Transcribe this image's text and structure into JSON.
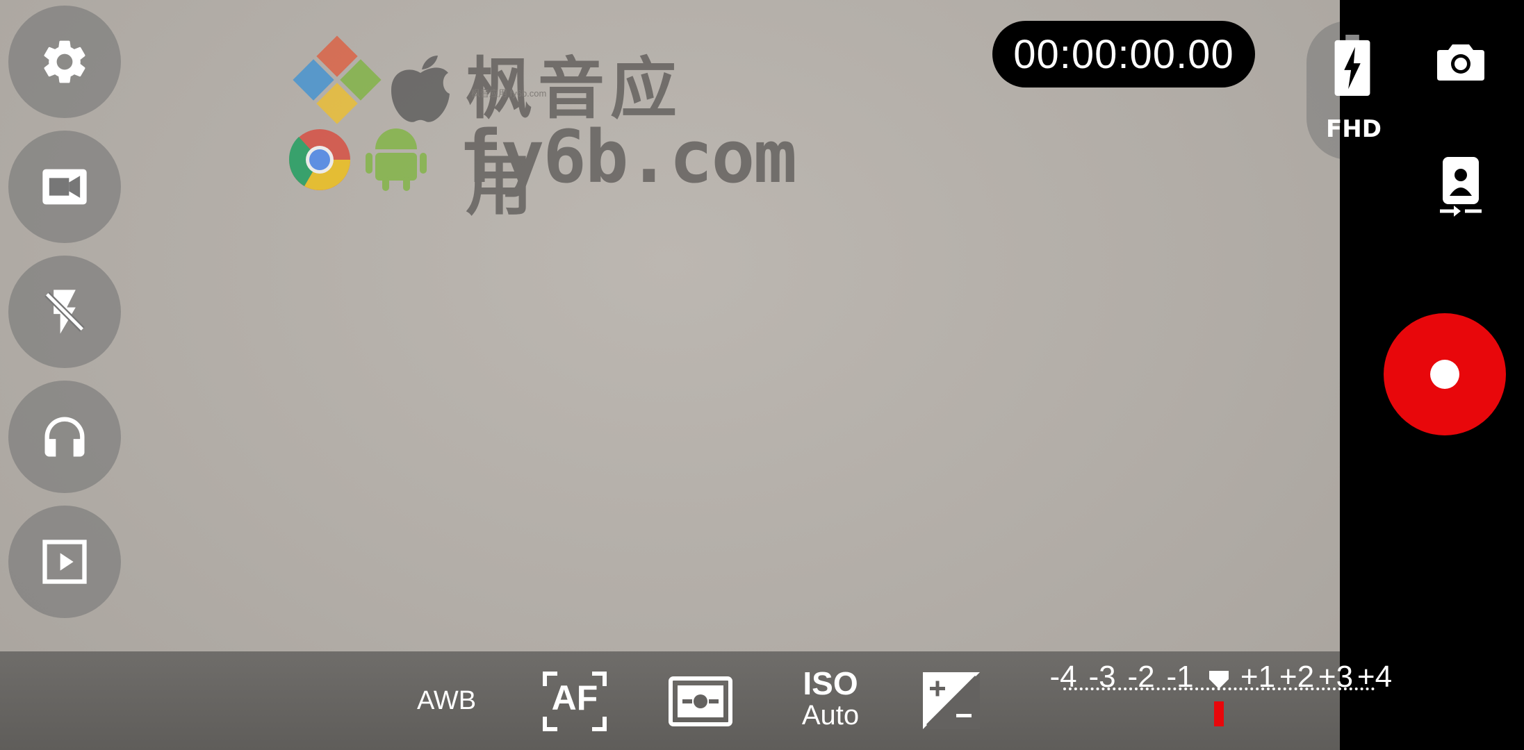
{
  "timer": {
    "elapsed": "00:00:00.00"
  },
  "watermark": {
    "title": "枫音应用",
    "url": "fy6b.com",
    "small": "枫音应用 fy6b.com"
  },
  "left_controls": [
    {
      "name": "settings-button",
      "icon": "gear-icon"
    },
    {
      "name": "video-mode-button",
      "icon": "video-camera-icon"
    },
    {
      "name": "flash-off-button",
      "icon": "flash-off-icon"
    },
    {
      "name": "audio-monitor-button",
      "icon": "headphones-icon"
    },
    {
      "name": "gallery-play-button",
      "icon": "play-icon"
    }
  ],
  "status": {
    "resolution": "FHD",
    "battery_icon": "battery-charging-icon"
  },
  "right_controls": {
    "photo_icon": "camera-icon",
    "switch_icon": "switch-camera-icon",
    "record_icon": "record-icon"
  },
  "toolbar": {
    "awb_label": "AWB",
    "af_label": "AF",
    "metering_icon": "metering-icon",
    "iso_title": "ISO",
    "iso_value": "Auto",
    "ev_icon": "exposure-compensation-icon"
  },
  "ev_scale": {
    "ticks": [
      "-4",
      "-3",
      "-2",
      "-1",
      "+1",
      "+2",
      "+3",
      "+4"
    ],
    "current_value": 0
  },
  "colors": {
    "record_red": "#e8070b",
    "bar_black": "#000000",
    "overlay_gray": "#787878"
  }
}
